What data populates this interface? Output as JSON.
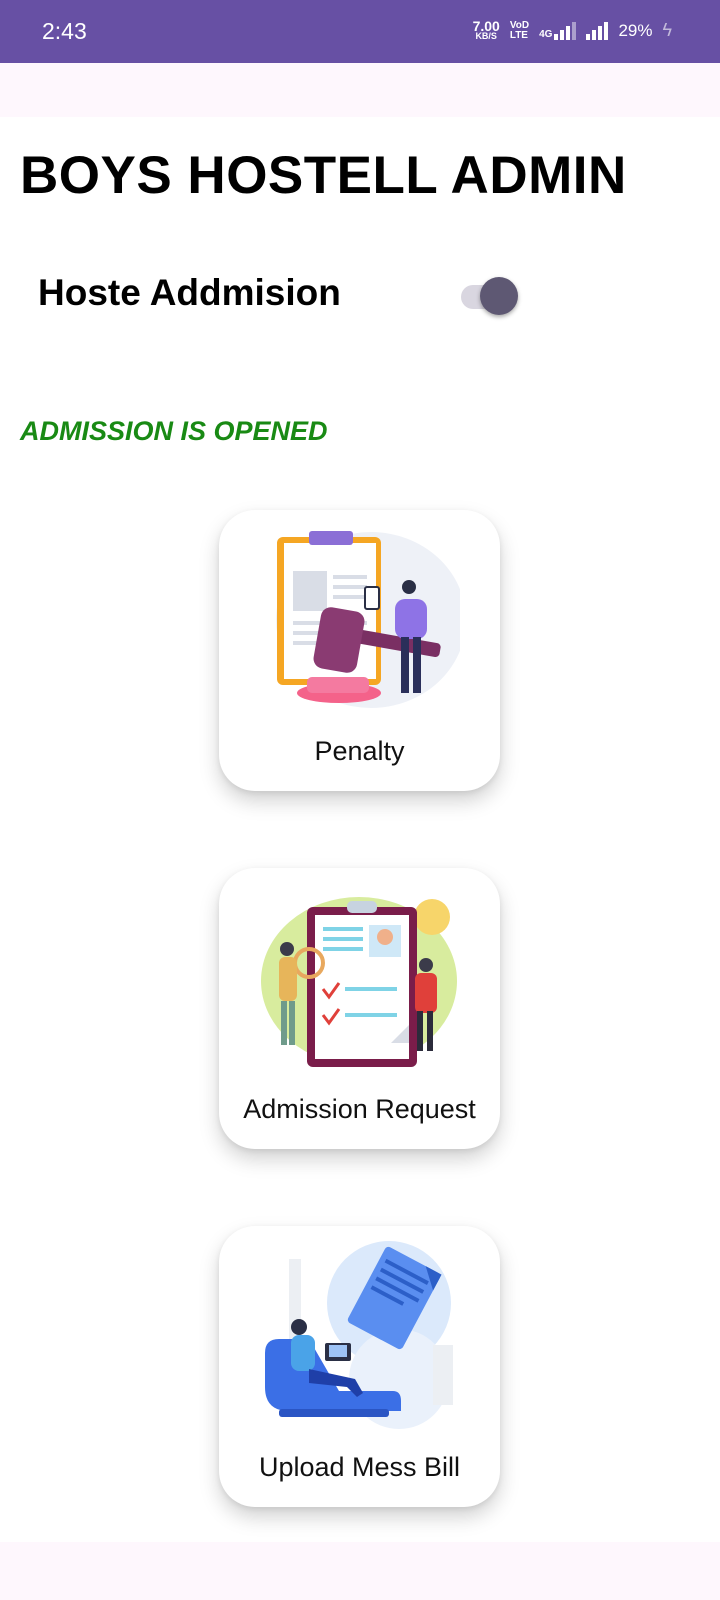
{
  "status_bar": {
    "time": "2:43",
    "speed_value": "7.00",
    "speed_unit": "KB/S",
    "volte_top": "VoD",
    "volte_bottom": "LTE",
    "network": "4G",
    "battery": "29%",
    "icons": [
      "signal-icon",
      "signal-icon",
      "charging-icon"
    ]
  },
  "header": {
    "title": "BOYS HOSTELL ADMIN"
  },
  "admission_toggle": {
    "label": "Hoste Addmision",
    "state": "on"
  },
  "admission_status": {
    "text": "ADMISSION IS OPENED",
    "color": "#198a14"
  },
  "cards": [
    {
      "label": "Penalty",
      "icon": "gavel-document-illustration"
    },
    {
      "label": "Admission Request",
      "icon": "application-form-illustration"
    },
    {
      "label": "Upload Mess Bill",
      "icon": "upload-document-illustration"
    }
  ],
  "colors": {
    "accent": "#6750a4",
    "switch_thumb": "#5e5873"
  }
}
